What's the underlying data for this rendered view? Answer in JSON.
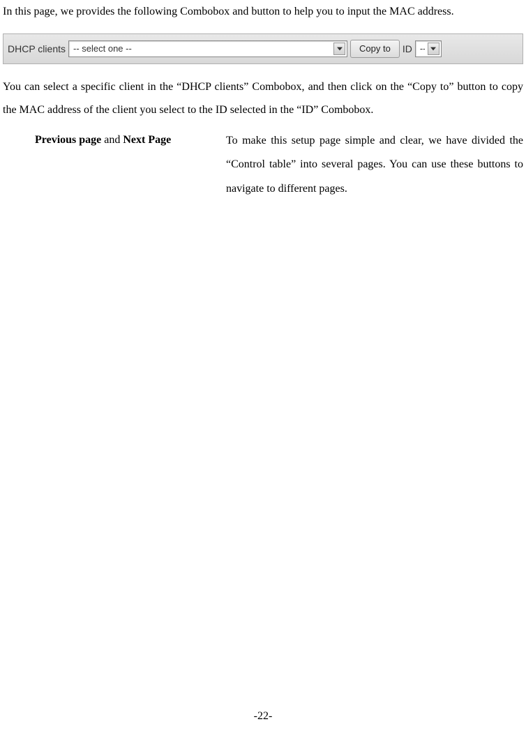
{
  "intro": "In this page, we provides the following Combobox and button to help you to input the MAC address.",
  "ui": {
    "dhcp_label": "DHCP clients",
    "dhcp_selected": "-- select one --",
    "copy_button": "Copy to",
    "id_label": "ID",
    "id_selected": "--"
  },
  "explain": "You can select a specific client in the “DHCP clients” Combobox, and then click on the “Copy to” button to copy the MAC address of the client you select to the ID selected in the “ID” Combobox.",
  "section": {
    "prev_label": "Previous page",
    "and": " and ",
    "next_label": "Next Page",
    "desc": "To make this setup page simple and clear, we have divided the “Control table” into several pages. You can use these buttons to navigate to different pages."
  },
  "page_number": "-22-"
}
